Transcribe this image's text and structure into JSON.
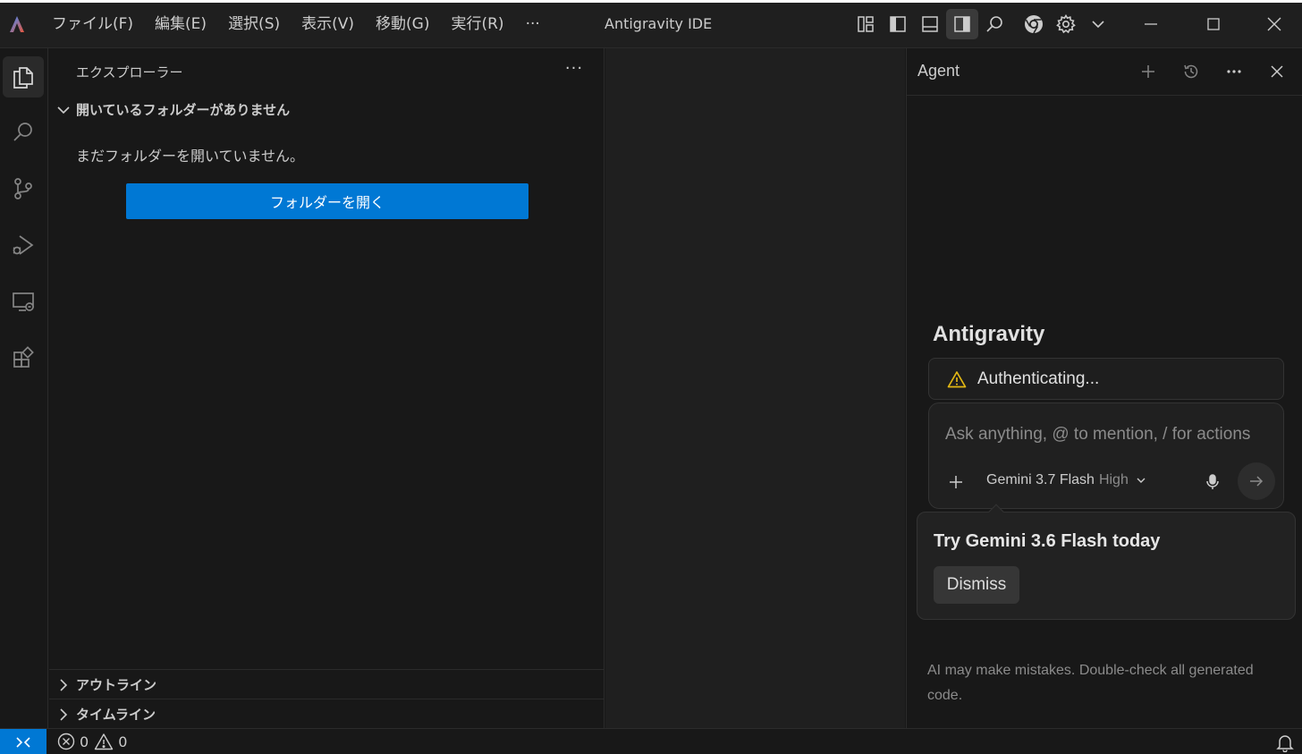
{
  "titlebar": {
    "menu": [
      "ファイル(F)",
      "編集(E)",
      "選択(S)",
      "表示(V)",
      "移動(G)",
      "実行(R)",
      "···"
    ],
    "window_title": "Antigravity IDE"
  },
  "sidebar": {
    "title": "エクスプローラー",
    "more": "···",
    "no_folder_section": "開いているフォルダーがありません",
    "empty_message": "まだフォルダーを開いていません。",
    "open_folder_button": "フォルダーを開く",
    "outline_section": "アウトライン",
    "timeline_section": "タイムライン"
  },
  "agent": {
    "title": "Agent",
    "brand": "Antigravity",
    "auth_status": "Authenticating...",
    "input_placeholder": "Ask anything, @ to mention, / for actions",
    "model": "Gemini 3.7 Flash",
    "model_mode": "High",
    "promo_title": "Try Gemini 3.6 Flash today",
    "dismiss_label": "Dismiss",
    "disclaimer": "AI may make mistakes. Double-check all generated code."
  },
  "statusbar": {
    "errors": "0",
    "warnings": "0"
  },
  "colors": {
    "accent": "#0078d4",
    "warning": "#e2b714",
    "background": "#181818"
  }
}
